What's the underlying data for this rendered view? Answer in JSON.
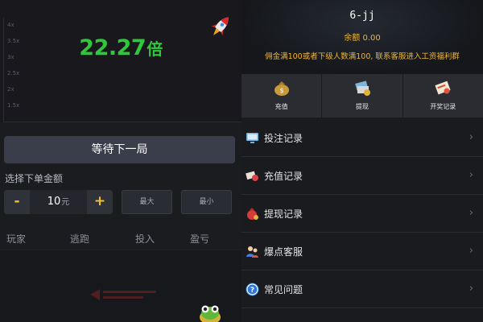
{
  "game": {
    "axis_ticks": [
      "4x",
      "3.5x",
      "3x",
      "2.5x",
      "2x",
      "1.5x"
    ],
    "multiplier_value": "22.27",
    "multiplier_unit": "倍",
    "wait_button_label": "等待下一局",
    "amount_label": "选择下单金额",
    "stepper": {
      "minus_label": "-",
      "value": "10",
      "unit": "元",
      "plus_label": "+"
    },
    "max_label": "最大",
    "min_label": "最小",
    "columns": [
      "玩家",
      "逃跑",
      "投入",
      "盈亏"
    ],
    "rocket_icon": "rocket-icon",
    "frog_icon": "frog-mascot-icon"
  },
  "account": {
    "username": "6-jj",
    "balance_label": "余额",
    "balance_value": "0.00",
    "notice": "佣金满100或者下级人数满100, 联系客服进入工资福利群",
    "quick_actions": [
      {
        "label": "充值",
        "icon": "money-bag-icon"
      },
      {
        "label": "提现",
        "icon": "cash-withdraw-icon"
      },
      {
        "label": "开奖记录",
        "icon": "lottery-record-icon"
      }
    ],
    "menu": [
      {
        "label": "投注记录",
        "icon": "monitor-icon"
      },
      {
        "label": "充值记录",
        "icon": "recharge-card-icon"
      },
      {
        "label": "提现记录",
        "icon": "red-bag-icon"
      },
      {
        "label": "爆点客服",
        "icon": "support-people-icon"
      },
      {
        "label": "常见问题",
        "icon": "question-icon"
      }
    ],
    "chevron": "›"
  },
  "colors": {
    "multiplier": "#2fc83b",
    "accent_gold": "#f0b52e",
    "stepper_symbol": "#f0c22a"
  }
}
